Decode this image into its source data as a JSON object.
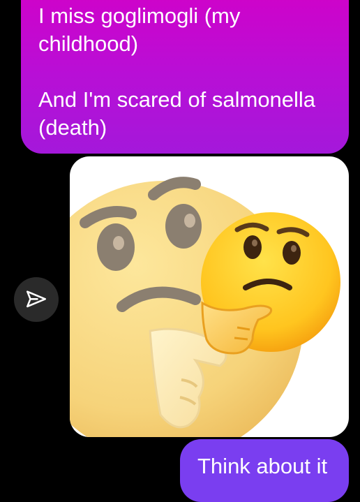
{
  "messages": [
    {
      "direction": "outgoing",
      "color": "#c40bcf",
      "lines": [
        "I miss goglimogli (my",
        "childhood)",
        "And I'm scared of salmonella",
        "(death)"
      ]
    },
    {
      "direction": "outgoing",
      "type": "image",
      "image_description_icon": "thinking-face-emoji"
    },
    {
      "direction": "outgoing",
      "color": "#7a3ef0",
      "text": "Think about it"
    }
  ],
  "actions": {
    "share_icon": "paper-plane-icon"
  }
}
